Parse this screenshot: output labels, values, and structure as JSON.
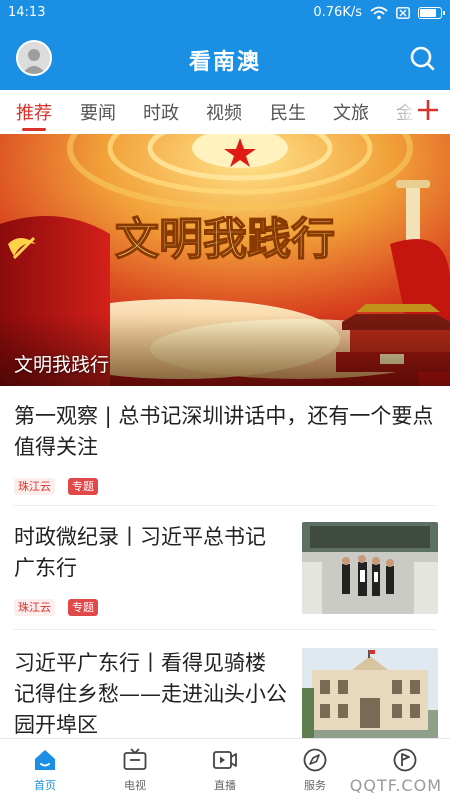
{
  "status_bar": {
    "time": "14:13",
    "network_speed": "0.76K/s",
    "battery_level": 0.85
  },
  "header": {
    "title": "看南澳",
    "avatar_icon": "user-avatar",
    "search_icon": "search-icon"
  },
  "tabs": [
    {
      "label": "推荐",
      "active": true
    },
    {
      "label": "要闻"
    },
    {
      "label": "时政"
    },
    {
      "label": "视频"
    },
    {
      "label": "民生"
    },
    {
      "label": "文旅"
    },
    {
      "label": "金"
    }
  ],
  "banner": {
    "caption": "文明我践行",
    "image_text": "文明我践行"
  },
  "news": [
    {
      "headline_lines": [
        "第一观察 | 总书记深圳讲话中，还有一个要点",
        "值得关注"
      ],
      "source": "珠江云",
      "topic": "专题"
    },
    {
      "headline_lines": [
        "时政微纪录丨习近平总书记",
        "广东行"
      ],
      "source": "珠江云",
      "topic": "专题"
    },
    {
      "headline_lines": [
        "习近平广东行丨看得见骑楼",
        "记得住乡愁——走进汕头小公",
        "园开埠区"
      ]
    }
  ],
  "bottom_nav": [
    {
      "label": "首页",
      "icon": "home-icon",
      "active": true
    },
    {
      "label": "电视",
      "icon": "tv-icon"
    },
    {
      "label": "直播",
      "icon": "live-video-icon"
    },
    {
      "label": "服务",
      "icon": "compass-icon"
    },
    {
      "label": "",
      "icon": "flag-circle-icon"
    }
  ],
  "watermark": "QQTF.COM",
  "colors": {
    "primary_blue": "#1a8fe3",
    "accent_red": "#d9322b"
  }
}
